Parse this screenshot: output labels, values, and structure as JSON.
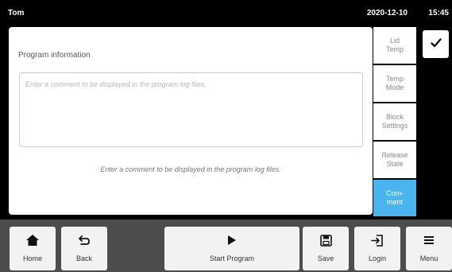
{
  "status": {
    "user": "Tom",
    "date": "2020-12-10",
    "time": "15:45"
  },
  "main": {
    "section_title": "Program information",
    "comment_placeholder": "Enter a comment to be displayed in the program log files.",
    "hint": "Enter a comment to be displayed in the program log files."
  },
  "side_tabs": [
    {
      "label": "Lid\nTemp",
      "active": false
    },
    {
      "label": "Temp\nMode",
      "active": false
    },
    {
      "label": "Block\nSettings",
      "active": false
    },
    {
      "label": "Release\nState",
      "active": false
    },
    {
      "label": "Com-\nment",
      "active": true
    }
  ],
  "confirm": {
    "icon": "checkmark-icon"
  },
  "nav": {
    "home": {
      "label": "Home",
      "icon": "home-icon"
    },
    "back": {
      "label": "Back",
      "icon": "back-arrow-icon"
    },
    "start_program": {
      "label": "Start Program",
      "icon": "play-icon"
    },
    "save": {
      "label": "Save",
      "icon": "save-icon"
    },
    "login": {
      "label": "Login",
      "icon": "login-icon"
    },
    "menu": {
      "label": "Menu",
      "icon": "menu-icon"
    }
  },
  "colors": {
    "accent": "#4ab4ee",
    "bottom_bar": "#4d4d4d",
    "button_bg": "#f2f2f2"
  }
}
